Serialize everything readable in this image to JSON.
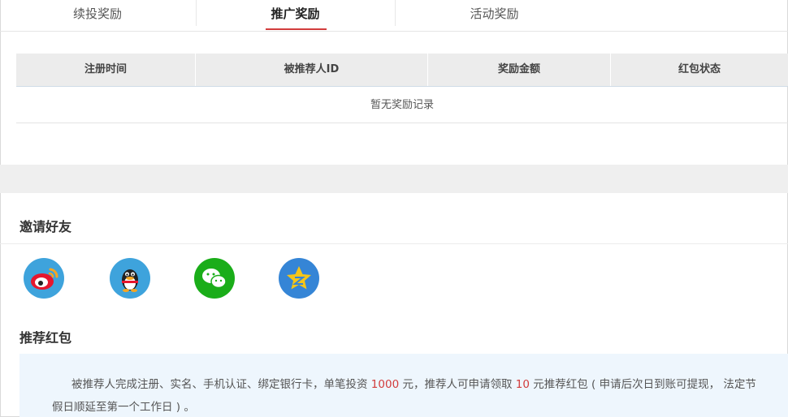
{
  "tabs": [
    {
      "label": "续投奖励"
    },
    {
      "label": "推广奖励"
    },
    {
      "label": "活动奖励"
    }
  ],
  "table": {
    "headers": [
      "注册时间",
      "被推荐人ID",
      "奖励金额",
      "红包状态"
    ],
    "empty_text": "暂无奖励记录"
  },
  "invite": {
    "title": "邀请好友",
    "share_targets": [
      {
        "icon": "weibo-icon",
        "color": "#3ea3dc"
      },
      {
        "icon": "qq-icon",
        "color": "#3ea3dc"
      },
      {
        "icon": "wechat-icon",
        "color": "#1aad19"
      },
      {
        "icon": "qzone-icon",
        "color": "#3585d6"
      }
    ]
  },
  "bonus": {
    "title": "推荐红包",
    "text_a": "被推荐人完成注册、实名、手机认证、绑定银行卡，单笔投资 ",
    "amount_1": "1000",
    "text_b": " 元，推荐人可申请领取 ",
    "amount_2": "10",
    "text_c": " 元推荐红包 ( 申请后次日到账可提现， 法定节假日顺延至第一个工作日 ) 。"
  },
  "colors": {
    "accent": "#d23c3c",
    "header_bg": "#ececec",
    "info_bg": "#eef6fd"
  }
}
